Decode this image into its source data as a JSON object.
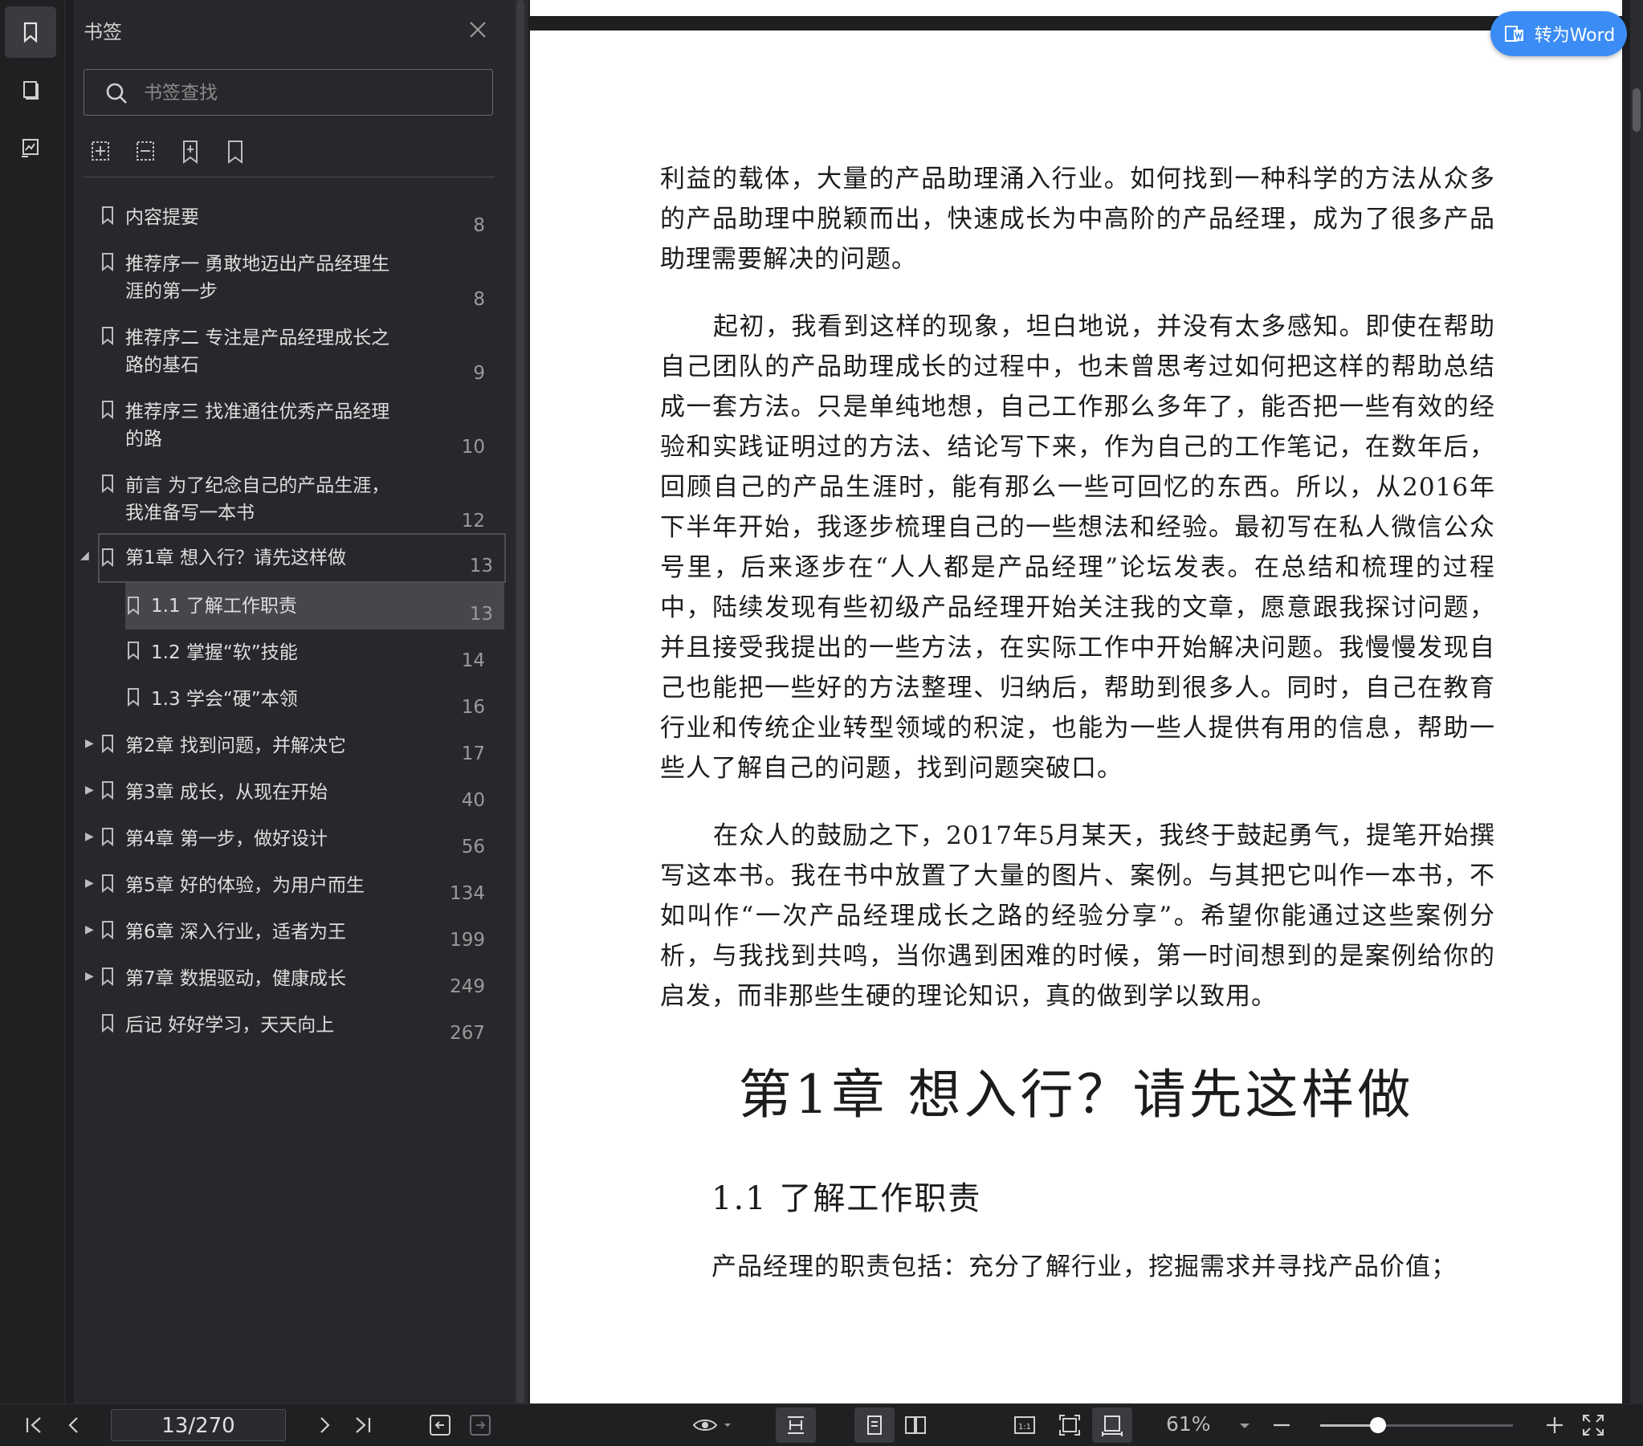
{
  "sidebar": {
    "title": "书签",
    "search_placeholder": "书签查找",
    "bookmarks": [
      {
        "label": "内容提要",
        "page": "8"
      },
      {
        "label": "推荐序一 勇敢地迈出产品经理生涯的第一步",
        "page": "8"
      },
      {
        "label": "推荐序二 专注是产品经理成长之路的基石",
        "page": "9"
      },
      {
        "label": "推荐序三 找准通往优秀产品经理的路",
        "page": "10"
      },
      {
        "label": "前言 为了纪念自己的产品生涯，我准备写一本书",
        "page": "12"
      },
      {
        "label": "第1章 想入行？请先这样做",
        "page": "13"
      },
      {
        "label": "1.1 了解工作职责",
        "page": "13"
      },
      {
        "label": "1.2 掌握“软”技能",
        "page": "14"
      },
      {
        "label": "1.3 学会“硬”本领",
        "page": "16"
      },
      {
        "label": "第2章 找到问题，并解决它",
        "page": "17"
      },
      {
        "label": "第3章 成长，从现在开始",
        "page": "40"
      },
      {
        "label": "第4章 第一步，做好设计",
        "page": "56"
      },
      {
        "label": "第5章 好的体验，为用户而生",
        "page": "134"
      },
      {
        "label": "第6章 深入行业，适者为王",
        "page": "199"
      },
      {
        "label": "第7章 数据驱动，健康成长",
        "page": "249"
      },
      {
        "label": "后记 好好学习，天天向上",
        "page": "267"
      }
    ]
  },
  "word_button": "转为Word",
  "document": {
    "paragraphs": [
      "利益的载体，大量的产品助理涌入行业。如何找到一种科学的方法从众多的产品助理中脱颖而出，快速成长为中高阶的产品经理，成为了很多产品助理需要解决的问题。",
      "起初，我看到这样的现象，坦白地说，并没有太多感知。即使在帮助自己团队的产品助理成长的过程中，也未曾思考过如何把这样的帮助总结成一套方法。只是单纯地想，自己工作那么多年了，能否把一些有效的经验和实践证明过的方法、结论写下来，作为自己的工作笔记，在数年后，回顾自己的产品生涯时，能有那么一些可回忆的东西。所以，从2016年下半年开始，我逐步梳理自己的一些想法和经验。最初写在私人微信公众号里，后来逐步在“人人都是产品经理”论坛发表。在总结和梳理的过程中，陆续发现有些初级产品经理开始关注我的文章，愿意跟我探讨问题，并且接受我提出的一些方法，在实际工作中开始解决问题。我慢慢发现自己也能把一些好的方法整理、归纳后，帮助到很多人。同时，自己在教育行业和传统企业转型领域的积淀，也能为一些人提供有用的信息，帮助一些人了解自己的问题，找到问题突破口。",
      "在众人的鼓励之下，2017年5月某天，我终于鼓起勇气，提笔开始撰写这本书。我在书中放置了大量的图片、案例。与其把它叫作一本书，不如叫作“一次产品经理成长之路的经验分享”。希望你能通过这些案例分析，与我找到共鸣，当你遇到困难的时候，第一时间想到的是案例给你的启发，而非那些生硬的理论知识，真的做到学以致用。"
    ],
    "chapter_title": "第1章 想入行？请先这样做",
    "section_title": "1.1 了解工作职责",
    "last_line": "产品经理的职责包括：充分了解行业，挖掘需求并寻找产品价值；"
  },
  "toolbar": {
    "page_indicator": "13/270",
    "zoom": "61%"
  }
}
